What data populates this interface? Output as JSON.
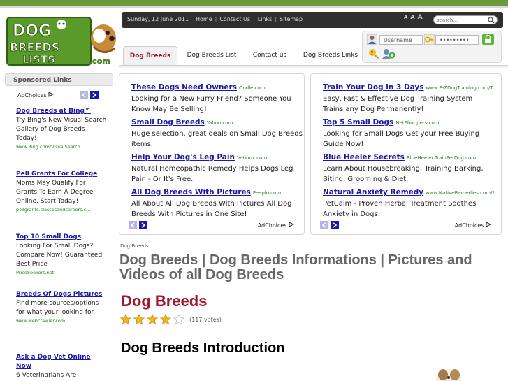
{
  "header": {
    "date": "Sunday, 12 June 2011",
    "toplinks": [
      "Home",
      "Contact Us",
      "Links",
      "Sitemap"
    ],
    "font_sizes": [
      "A",
      "A",
      "A"
    ],
    "search": {
      "placeholder": "search..."
    }
  },
  "login": {
    "username_placeholder": "Username",
    "password_value": "•••••••••"
  },
  "tabs": [
    {
      "label": "Dog Breeds",
      "active": true
    },
    {
      "label": "Dog Breeds List"
    },
    {
      "label": "Contact us"
    },
    {
      "label": "Dog Breeds Links"
    }
  ],
  "sidebar": {
    "title": "Sponsored Links",
    "adchoices": "AdChoices",
    "ads": [
      {
        "title": "Dog Breeds at Bing™",
        "body": "Try Bing's New Visual Search Gallery of Dog Breeds Today!",
        "url": "www.Bing.com/VisualSearch"
      },
      {
        "title": "Pell Grants For College",
        "body": "Moms May Qualify For Grants To Earn A Degree Online. Start Today!",
        "url": "pellgrants.classesandcareers.c..."
      },
      {
        "title": "Top 10 Small Dogs",
        "body": "Looking For Small Dogs? Compare Now! Guaranteed Best Price",
        "url": "PriceSeekers.net"
      },
      {
        "title": "Breeds Of Dogs Pictures",
        "body": "Find more sources/options for what your looking for",
        "url": "www.webcrawler.com"
      },
      {
        "title": "Ask a Dog Vet Online Now",
        "body": "6 Veterinarians Are",
        "url": ""
      }
    ]
  },
  "adpanels": [
    {
      "adchoices": "AdChoices",
      "ads": [
        {
          "title": "These Dogs Need Owners",
          "url": "Oodle.com",
          "body": "Looking for a New Furry Friend? Someone You Know May Be Selling!"
        },
        {
          "title": "Small Dog Breeds",
          "url": "Yahoo.com",
          "body": "Huge selection, great deals on Small Dog Breeds items."
        },
        {
          "title": "Help Your Dog's Leg Pain",
          "url": "Vetionx.com",
          "body": "Natural Homeopathic Remedy Helps Dogs Leg Pain - Or It's Free."
        },
        {
          "title": "All Dog Breeds With Pictures",
          "url": "Peeplo.com",
          "body": "All About All Dog Breeds With Pictures All Dog Breeds With Pictures in One Site!"
        }
      ]
    },
    {
      "adchoices": "AdChoices",
      "ads": [
        {
          "title": "Train Your Dog in 3 Days",
          "url": "www.E-ZDogTraining.com/Try...",
          "body": "Easy, Fast & Effective Dog Training System Trains any Dog Permanently!"
        },
        {
          "title": "Top 5 Small Dogs",
          "url": "NetShoppers.com",
          "body": "Looking for Small Dogs Get your Free Buying Guide Now!"
        },
        {
          "title": "Blue Heeler Secrets",
          "url": "BlueHeeler.TrainPetDog.com",
          "body": "Learn About Housebreaking, Training Barking, Biting, Grooming & Diet."
        },
        {
          "title": "Natural Anxiety Remedy",
          "url": "www.NativeRemedies.com/Pet...",
          "body": "PetCalm - Proven Herbal Treatment Soothes Anxiety in Dogs."
        }
      ]
    }
  ],
  "content": {
    "breadcrumb": "Dog Breeds",
    "page_title": "Dog Breeds | Dog Breeds Informations | Pictures and Videos of all Dog Breeds",
    "article_title": "Dog Breeds",
    "rating": {
      "stars_filled": 4,
      "stars_total": 5,
      "votes": "(117 votes)"
    },
    "intro_heading": "Dog Breeds Introduction"
  },
  "colors": {
    "brand_green": "#6c9a3a",
    "accent_red": "#a0162a",
    "link_blue": "#1a1aa8",
    "url_green": "#1a8a1a"
  }
}
